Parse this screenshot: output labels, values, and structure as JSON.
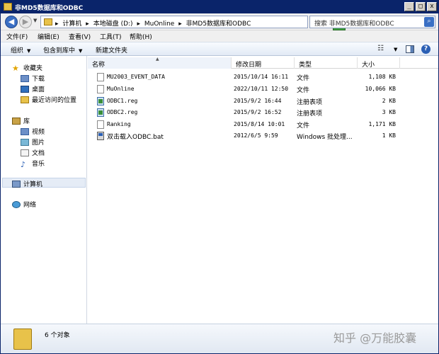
{
  "window": {
    "title": "非MD5数据库和ODBC"
  },
  "address": {
    "segments": [
      "计算机",
      "本地磁盘 (D:)",
      "MuOnline",
      "非MD5数据库和ODBC"
    ],
    "separator": "▸"
  },
  "search": {
    "text": "搜索 非MD5数据库和ODBC"
  },
  "menu": [
    "文件(F)",
    "编辑(E)",
    "查看(V)",
    "工具(T)",
    "帮助(H)"
  ],
  "commands": {
    "organize": "组织",
    "include": "包含到库中",
    "new_folder": "新建文件夹"
  },
  "nav": {
    "favorites": {
      "label": "收藏夹",
      "items": [
        "下载",
        "桌面",
        "最近访问的位置"
      ]
    },
    "libraries": {
      "label": "库",
      "items": [
        "视频",
        "图片",
        "文档",
        "音乐"
      ]
    },
    "computer": "计算机",
    "network": "网络"
  },
  "columns": {
    "name": "名称",
    "date": "修改日期",
    "type": "类型",
    "size": "大小"
  },
  "files": [
    {
      "name": "MU2003_EVENT_DATA",
      "date": "2015/10/14 16:11",
      "type": "文件",
      "size": "1,108 KB",
      "icon": "file-icon"
    },
    {
      "name": "MuOnline",
      "date": "2022/10/11 12:50",
      "type": "文件",
      "size": "10,066 KB",
      "icon": "file-icon"
    },
    {
      "name": "ODBC1.reg",
      "date": "2015/9/2 16:44",
      "type": "注册表项",
      "size": "2 KB",
      "icon": "registry-file-icon"
    },
    {
      "name": "ODBC2.reg",
      "date": "2015/9/2 16:52",
      "type": "注册表项",
      "size": "3 KB",
      "icon": "registry-file-icon"
    },
    {
      "name": "Ranking",
      "date": "2015/8/14 10:01",
      "type": "文件",
      "size": "1,171 KB",
      "icon": "file-icon"
    },
    {
      "name": "双击载入ODBC.bat",
      "date": "2012/6/5 9:59",
      "type": "Windows 批处理...",
      "size": "1 KB",
      "icon": "batch-file-icon"
    }
  ],
  "status": {
    "count": "6 个对象"
  },
  "watermark": "知乎 @万能胶囊"
}
